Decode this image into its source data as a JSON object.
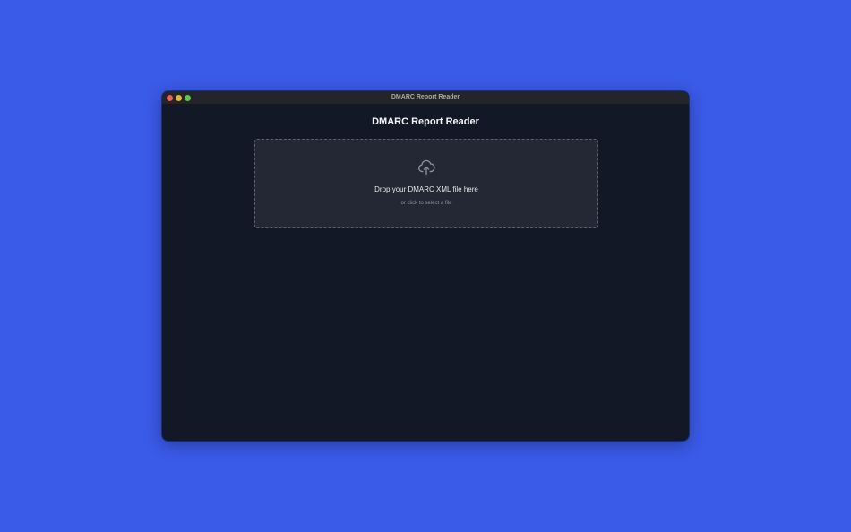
{
  "window": {
    "title": "DMARC Report Reader"
  },
  "app": {
    "heading": "DMARC Report Reader"
  },
  "dropzone": {
    "primary_text": "Drop your DMARC XML file here",
    "secondary_text": "or click to select a file",
    "icon": "cloud-upload-icon"
  },
  "colors": {
    "desktop_background": "#3a5ae8",
    "window_background": "#121826",
    "dropzone_background": "#232834",
    "dropzone_border": "#5a6070"
  }
}
